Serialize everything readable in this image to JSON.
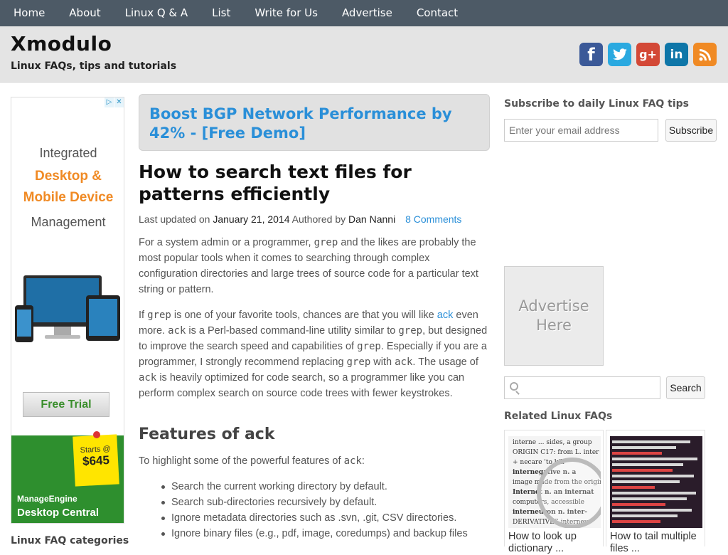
{
  "nav": [
    "Home",
    "About",
    "Linux Q & A",
    "List",
    "Write for Us",
    "Advertise",
    "Contact"
  ],
  "header": {
    "title": "Xmodulo",
    "tagline": "Linux FAQs, tips and tutorials"
  },
  "social": {
    "facebook": "f",
    "twitter": "t",
    "googleplus": "g+",
    "linkedin": "in",
    "rss": "rss"
  },
  "left_ad": {
    "line1": "Integrated",
    "line2": "Desktop &",
    "line3": "Mobile Device",
    "line4": "Management",
    "trial": "Free Trial",
    "starts": "Starts @",
    "price": "$645",
    "brand1": "ManageEngine",
    "brand2": "Desktop Central"
  },
  "left_sidebar": {
    "categories_heading": "Linux FAQ categories"
  },
  "banner": {
    "text": "Boost BGP Network Performance by 42% - [Free Demo]"
  },
  "article": {
    "title": "How to search text files for patterns efficiently",
    "meta": {
      "updated_label": "Last updated on",
      "date": "January 21, 2014",
      "author_label": "Authored by",
      "author": "Dan Nanni",
      "comments": "8 Comments"
    },
    "p1": {
      "a": "For a system admin or a programmer, ",
      "code1": "grep",
      "b": " and the likes are probably the most popular tools when it comes to searching through complex configuration directories and large trees of source code for a particular text string or pattern."
    },
    "p2": {
      "a": "If ",
      "c1": "grep",
      "b": " is one of your favorite tools, chances are that you will like ",
      "link": "ack",
      "c": " even more. ",
      "c2": "ack",
      "d": " is a Perl-based command-line utility similar to ",
      "c3": "grep",
      "e": ", but designed to improve the search speed and capabilities of ",
      "c4": "grep",
      "f": ". Especially if you are a programmer, I strongly recommend replacing ",
      "c5": "grep",
      "g": " with ",
      "c6": "ack",
      "h": ". The usage of ",
      "c7": "ack",
      "i": " is heavily optimized for code search, so a programmer like you can perform complex search on source code trees with fewer keystrokes."
    },
    "features_heading": "Features of ack",
    "p3": {
      "a": "To highlight some of the powerful features of ",
      "code": "ack",
      "b": ":"
    },
    "features": [
      "Search the current working directory by default.",
      "Search sub-directories recursively by default.",
      "Ignore metadata directories such as .svn, .git, CSV directories.",
      "Ignore binary files (e.g., pdf, image, coredumps) and backup files"
    ]
  },
  "right_sidebar": {
    "subscribe_heading": "Subscribe to daily Linux FAQ tips",
    "email_placeholder": "Enter your email address",
    "subscribe_button": "Subscribe",
    "advertise_line1": "Advertise",
    "advertise_line2": "Here",
    "search_button": "Search",
    "related_heading": "Related Linux FAQs",
    "related": [
      {
        "title": "How to look up dictionary ..."
      },
      {
        "title": "How to tail multiple files ..."
      }
    ]
  }
}
